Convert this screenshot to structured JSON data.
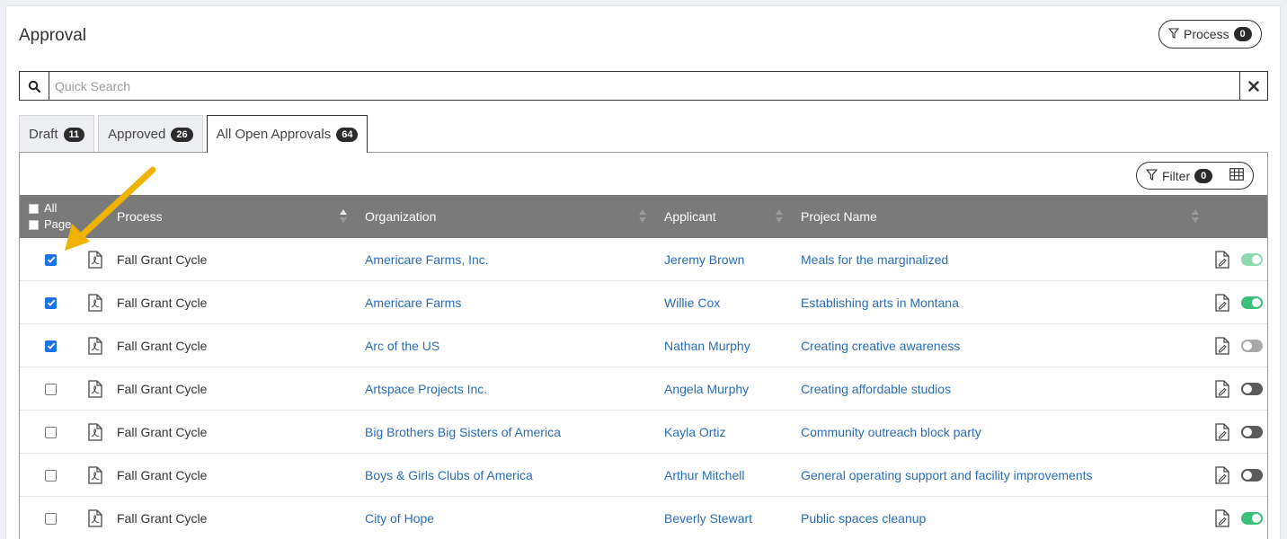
{
  "page": {
    "title": "Approval",
    "process_label": "Process",
    "process_count": "0"
  },
  "search": {
    "placeholder": "Quick Search"
  },
  "tabs": [
    {
      "label": "Draft",
      "count": "11"
    },
    {
      "label": "Approved",
      "count": "26"
    },
    {
      "label": "All Open Approvals",
      "count": "64"
    }
  ],
  "toolbar": {
    "filter_label": "Filter",
    "filter_count": "0"
  },
  "table": {
    "select_all_label": "All",
    "select_page_label": "Page",
    "columns": {
      "process": "Process",
      "organization": "Organization",
      "applicant": "Applicant",
      "project": "Project Name"
    },
    "rows": [
      {
        "checked": true,
        "process": "Fall Grant Cycle",
        "organization": "Americare Farms, Inc.",
        "applicant": "Jeremy Brown",
        "project": "Meals for the marginalized",
        "toggle": "on-light"
      },
      {
        "checked": true,
        "process": "Fall Grant Cycle",
        "organization": "Americare Farms",
        "applicant": "Willie Cox",
        "project": "Establishing arts in Montana",
        "toggle": "on"
      },
      {
        "checked": true,
        "process": "Fall Grant Cycle",
        "organization": "Arc of the US",
        "applicant": "Nathan Murphy",
        "project": "Creating creative awareness",
        "toggle": "off-light"
      },
      {
        "checked": false,
        "process": "Fall Grant Cycle",
        "organization": "Artspace Projects Inc.",
        "applicant": "Angela Murphy",
        "project": "Creating affordable studios",
        "toggle": "off"
      },
      {
        "checked": false,
        "process": "Fall Grant Cycle",
        "organization": "Big Brothers Big Sisters of America",
        "applicant": "Kayla Ortiz",
        "project": "Community outreach block party",
        "toggle": "off"
      },
      {
        "checked": false,
        "process": "Fall Grant Cycle",
        "organization": "Boys & Girls Clubs of America",
        "applicant": "Arthur Mitchell",
        "project": "General operating support and facility improvements",
        "toggle": "off"
      },
      {
        "checked": false,
        "process": "Fall Grant Cycle",
        "organization": "City of Hope",
        "applicant": "Beverly Stewart",
        "project": "Public spaces cleanup",
        "toggle": "on"
      }
    ]
  },
  "colors": {
    "link": "#2a6db5",
    "header_bg": "#7a7a7a",
    "checkbox_on": "#1a73e8",
    "toggle_on": "#3cbf7a",
    "toggle_on_light": "#8fd9b0",
    "toggle_off": "#5a5a5a",
    "toggle_off_light": "#a8a8a8",
    "arrow": "#f0b400"
  },
  "icons": {
    "search": "search-icon",
    "clear": "close-icon",
    "filter": "filter-icon",
    "columns": "table-grid-icon",
    "pdf": "pdf-file-icon",
    "edit": "edit-document-icon"
  }
}
